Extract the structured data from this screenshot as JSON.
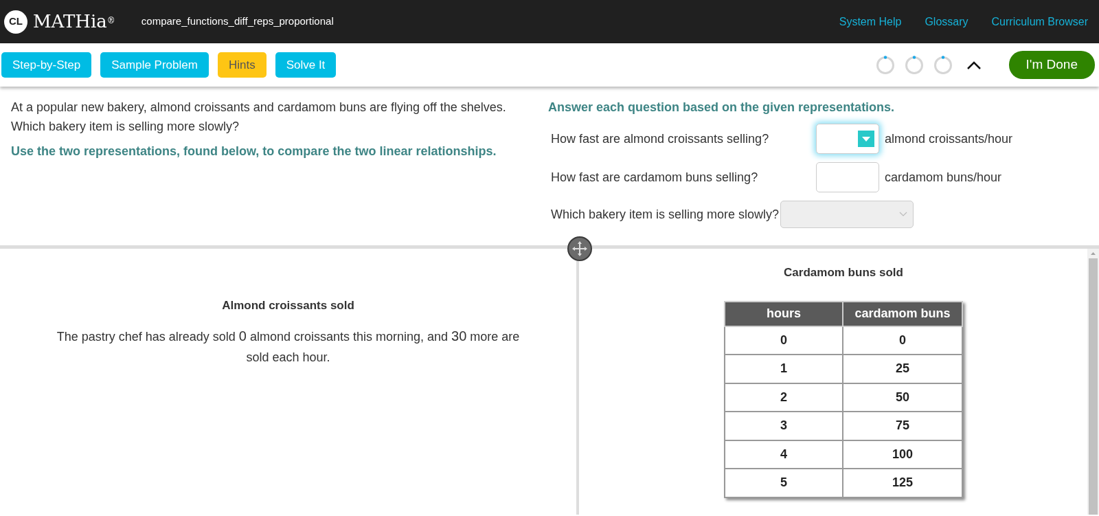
{
  "header": {
    "logo_mark": "CL",
    "logo_text": "MATHia",
    "logo_sup": "®",
    "problem_name": "compare_functions_diff_reps_proportional",
    "links": [
      {
        "label": "System Help"
      },
      {
        "label": "Glossary"
      },
      {
        "label": "Curriculum Browser"
      }
    ]
  },
  "toolbar": {
    "buttons": [
      {
        "label": "Step-by-Step",
        "kind": "info"
      },
      {
        "label": "Sample Problem",
        "kind": "info"
      },
      {
        "label": "Hints",
        "kind": "warning"
      },
      {
        "label": "Solve It",
        "kind": "info"
      }
    ],
    "done_button": "I'm Done"
  },
  "problem": {
    "intro": "At a popular new bakery, almond croissants and cardamom buns are flying off the shelves. Which bakery item is selling more slowly?",
    "instruction": "Use the two representations, found below, to compare the two linear relationships."
  },
  "questions": {
    "heading": "Answer each question based on the given representations.",
    "items": [
      {
        "kind": "dropdown-input",
        "question": "How fast are almond croissants selling?",
        "focused": true,
        "unit": "almond croissants/hour"
      },
      {
        "kind": "input",
        "question": "How fast are cardamom buns selling?",
        "focused": false,
        "unit": "cardamom buns/hour"
      },
      {
        "kind": "select",
        "question": "Which bakery item is selling more slowly?",
        "disabled": true
      }
    ]
  },
  "left_panel": {
    "title": "Almond croissants sold",
    "statement": [
      {
        "kind": "text",
        "text": "The pastry chef has already sold "
      },
      {
        "kind": "value",
        "text": "0"
      },
      {
        "kind": "text",
        "text": " almond croissants this morning, and "
      },
      {
        "kind": "value",
        "text": "30"
      },
      {
        "kind": "text",
        "text": " more are sold each hour."
      }
    ]
  },
  "right_panel": {
    "title": "Cardamom buns sold",
    "table": {
      "columns": [
        "hours",
        "cardamom buns"
      ],
      "rows": [
        [
          "0",
          "0"
        ],
        [
          "1",
          "25"
        ],
        [
          "2",
          "50"
        ],
        [
          "3",
          "75"
        ],
        [
          "4",
          "100"
        ],
        [
          "5",
          "125"
        ]
      ]
    }
  }
}
